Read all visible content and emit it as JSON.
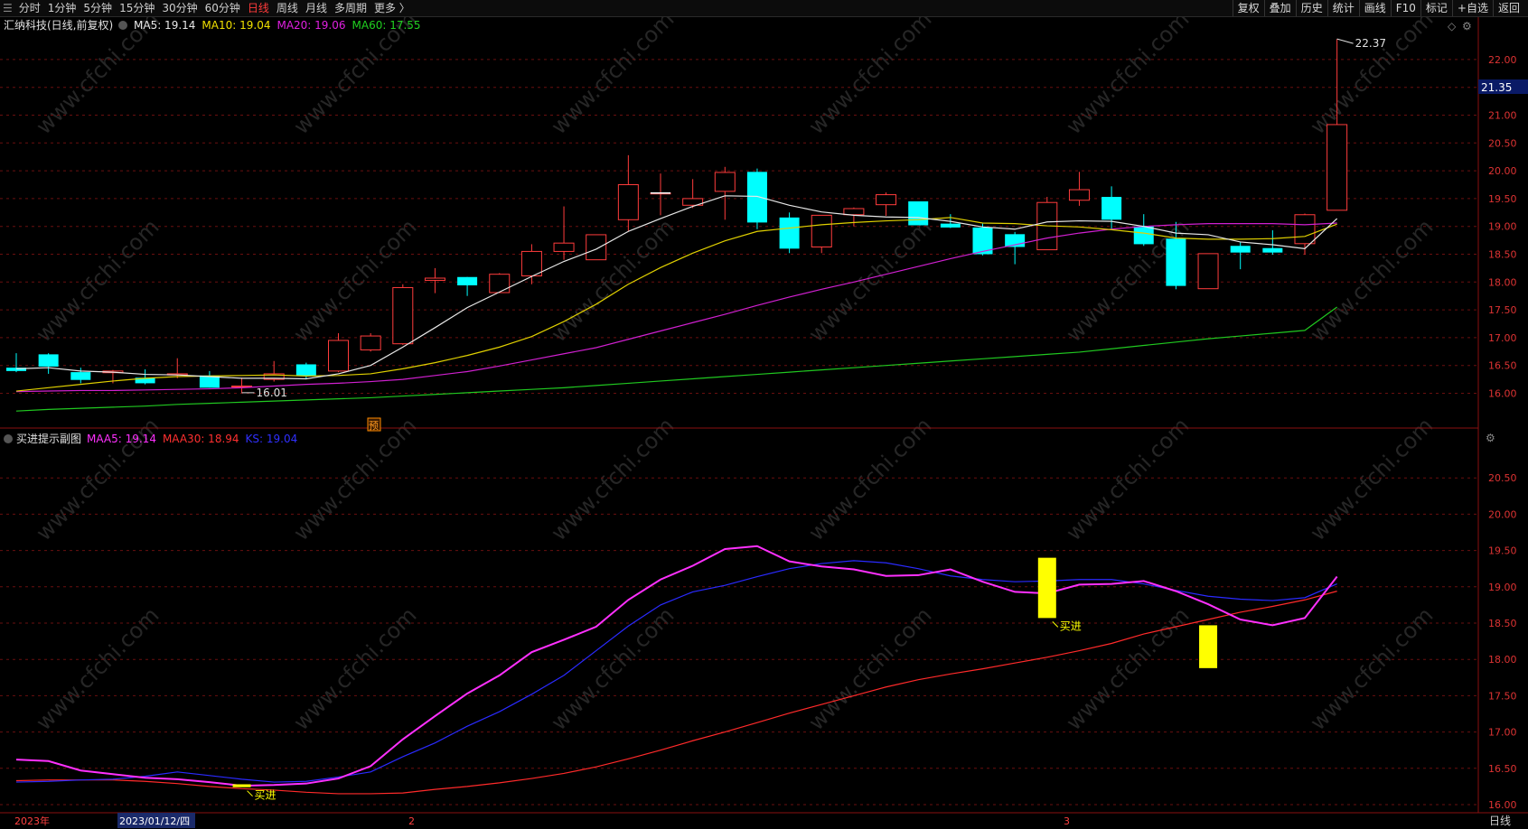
{
  "toolbar": {
    "menu_glyph": "☰",
    "left_items": [
      {
        "label": "分时",
        "active": false
      },
      {
        "label": "1分钟",
        "active": false
      },
      {
        "label": "5分钟",
        "active": false
      },
      {
        "label": "15分钟",
        "active": false
      },
      {
        "label": "30分钟",
        "active": false
      },
      {
        "label": "60分钟",
        "active": false
      },
      {
        "label": "日线",
        "active": true
      },
      {
        "label": "周线",
        "active": false
      },
      {
        "label": "月线",
        "active": false
      },
      {
        "label": "多周期",
        "active": false
      },
      {
        "label": "更多 〉",
        "active": false
      }
    ],
    "right_items": [
      "复权",
      "叠加",
      "历史",
      "统计",
      "画线",
      "F10",
      "标记",
      "+自选",
      "返回"
    ]
  },
  "main_panel": {
    "title": "汇纳科技(日线,前复权)",
    "indicators": [
      {
        "label": "MA5: 19.14",
        "color": "#e8e8e8"
      },
      {
        "label": "MA10: 19.04",
        "color": "#f0e000"
      },
      {
        "label": "MA20: 19.06",
        "color": "#e020e0"
      },
      {
        "label": "MA60: 17.55",
        "color": "#20d020"
      }
    ],
    "price_label": "21.35",
    "high_label": "22.37",
    "low_label": "16.01",
    "forecast_badge": "预",
    "y_ticks": [
      "22.00",
      "21.50",
      "21.00",
      "20.50",
      "20.00",
      "19.50",
      "19.00",
      "18.50",
      "18.00",
      "17.50",
      "17.00",
      "16.50",
      "16.00"
    ]
  },
  "sub_panel": {
    "title": "买进提示副图",
    "indicators": [
      {
        "label": "MAA5: 19.14",
        "color": "#ff30ff"
      },
      {
        "label": "MAA30: 18.94",
        "color": "#ff3030"
      },
      {
        "label": "KS: 19.04",
        "color": "#3030ff"
      }
    ],
    "buy_label": "买进",
    "y_ticks": [
      "20.50",
      "20.00",
      "19.50",
      "19.00",
      "18.50",
      "18.00",
      "17.50",
      "17.00",
      "16.50",
      "16.00"
    ]
  },
  "x_axis": {
    "labels": [
      "2023年",
      "2023/01/12/四",
      "2",
      "3"
    ],
    "period_label": "日线"
  },
  "watermark": "www.cfchi.com",
  "chart_data": {
    "type": "candlestick",
    "title": "汇纳科技(日线,前复权)",
    "candles": [
      {
        "o": 16.46,
        "h": 16.72,
        "l": 16.38,
        "c": 16.4
      },
      {
        "o": 16.7,
        "h": 16.72,
        "l": 16.35,
        "c": 16.48
      },
      {
        "o": 16.38,
        "h": 16.46,
        "l": 16.18,
        "c": 16.24
      },
      {
        "o": 16.37,
        "h": 16.42,
        "l": 16.18,
        "c": 16.4
      },
      {
        "o": 16.28,
        "h": 16.43,
        "l": 16.16,
        "c": 16.18
      },
      {
        "o": 16.33,
        "h": 16.63,
        "l": 16.27,
        "c": 16.35
      },
      {
        "o": 16.32,
        "h": 16.4,
        "l": 16.1,
        "c": 16.1
      },
      {
        "o": 16.13,
        "h": 16.28,
        "l": 16.01,
        "c": 16.13
      },
      {
        "o": 16.25,
        "h": 16.58,
        "l": 16.21,
        "c": 16.35
      },
      {
        "o": 16.52,
        "h": 16.55,
        "l": 16.25,
        "c": 16.31
      },
      {
        "o": 16.4,
        "h": 17.08,
        "l": 16.38,
        "c": 16.95
      },
      {
        "o": 16.78,
        "h": 17.08,
        "l": 16.75,
        "c": 17.03
      },
      {
        "o": 16.89,
        "h": 17.96,
        "l": 16.87,
        "c": 17.9
      },
      {
        "o": 18.03,
        "h": 18.25,
        "l": 17.8,
        "c": 18.07
      },
      {
        "o": 18.09,
        "h": 18.09,
        "l": 17.75,
        "c": 17.94
      },
      {
        "o": 17.81,
        "h": 18.16,
        "l": 17.8,
        "c": 18.14
      },
      {
        "o": 18.11,
        "h": 18.68,
        "l": 17.96,
        "c": 18.55
      },
      {
        "o": 18.55,
        "h": 19.36,
        "l": 18.4,
        "c": 18.7
      },
      {
        "o": 18.4,
        "h": 18.85,
        "l": 18.4,
        "c": 18.85
      },
      {
        "o": 19.12,
        "h": 20.28,
        "l": 18.92,
        "c": 19.75
      },
      {
        "o": 19.6,
        "h": 19.95,
        "l": 19.2,
        "c": 19.6
      },
      {
        "o": 19.38,
        "h": 19.85,
        "l": 19.33,
        "c": 19.5
      },
      {
        "o": 19.63,
        "h": 20.07,
        "l": 19.12,
        "c": 19.97
      },
      {
        "o": 19.98,
        "h": 20.04,
        "l": 18.95,
        "c": 19.07
      },
      {
        "o": 19.16,
        "h": 19.25,
        "l": 18.52,
        "c": 18.6
      },
      {
        "o": 18.63,
        "h": 19.2,
        "l": 18.52,
        "c": 19.2
      },
      {
        "o": 19.21,
        "h": 19.34,
        "l": 19.0,
        "c": 19.32
      },
      {
        "o": 19.39,
        "h": 19.61,
        "l": 19.19,
        "c": 19.57
      },
      {
        "o": 19.45,
        "h": 19.45,
        "l": 19.02,
        "c": 19.02
      },
      {
        "o": 19.05,
        "h": 19.22,
        "l": 18.97,
        "c": 18.98
      },
      {
        "o": 18.98,
        "h": 19.05,
        "l": 18.48,
        "c": 18.5
      },
      {
        "o": 18.86,
        "h": 18.9,
        "l": 18.32,
        "c": 18.63
      },
      {
        "o": 18.58,
        "h": 19.53,
        "l": 18.58,
        "c": 19.43
      },
      {
        "o": 19.47,
        "h": 19.98,
        "l": 19.37,
        "c": 19.66
      },
      {
        "o": 19.53,
        "h": 19.72,
        "l": 18.96,
        "c": 19.12
      },
      {
        "o": 19.0,
        "h": 19.22,
        "l": 18.65,
        "c": 18.68
      },
      {
        "o": 18.78,
        "h": 19.08,
        "l": 17.87,
        "c": 17.93
      },
      {
        "o": 17.88,
        "h": 18.51,
        "l": 17.88,
        "c": 18.51
      },
      {
        "o": 18.65,
        "h": 18.72,
        "l": 18.23,
        "c": 18.53
      },
      {
        "o": 18.61,
        "h": 18.93,
        "l": 18.49,
        "c": 18.53
      },
      {
        "o": 18.69,
        "h": 19.23,
        "l": 18.49,
        "c": 19.21
      },
      {
        "o": 19.29,
        "h": 22.37,
        "l": 19.29,
        "c": 20.83
      }
    ],
    "ma5": [
      16.44,
      16.46,
      16.4,
      16.38,
      16.34,
      16.33,
      16.3,
      16.27,
      16.27,
      16.26,
      16.35,
      16.5,
      16.83,
      17.18,
      17.54,
      17.82,
      18.1,
      18.37,
      18.59,
      18.91,
      19.14,
      19.36,
      19.55,
      19.54,
      19.38,
      19.26,
      19.2,
      19.17,
      19.16,
      19.09,
      18.99,
      18.95,
      19.08,
      19.1,
      19.09,
      19.0,
      18.88,
      18.85,
      18.72,
      18.67,
      18.6,
      19.14
    ],
    "ma10": [
      16.04,
      16.1,
      16.16,
      16.22,
      16.27,
      16.3,
      16.31,
      16.32,
      16.33,
      16.31,
      16.32,
      16.35,
      16.44,
      16.55,
      16.68,
      16.83,
      17.02,
      17.29,
      17.6,
      17.96,
      18.26,
      18.52,
      18.74,
      18.91,
      18.97,
      19.03,
      19.07,
      19.1,
      19.12,
      19.16,
      19.06,
      19.05,
      19.01,
      18.99,
      18.94,
      18.88,
      18.79,
      18.77,
      18.77,
      18.78,
      18.82,
      19.04
    ],
    "ma20": [
      16.03,
      16.04,
      16.05,
      16.05,
      16.06,
      16.07,
      16.08,
      16.1,
      16.13,
      16.16,
      16.18,
      16.21,
      16.25,
      16.32,
      16.39,
      16.49,
      16.6,
      16.71,
      16.82,
      16.97,
      17.12,
      17.27,
      17.42,
      17.58,
      17.73,
      17.87,
      18.0,
      18.14,
      18.28,
      18.42,
      18.55,
      18.67,
      18.79,
      18.88,
      18.95,
      19.0,
      19.03,
      19.05,
      19.05,
      19.05,
      19.03,
      19.06
    ],
    "ma60": [
      15.68,
      15.71,
      15.73,
      15.75,
      15.77,
      15.8,
      15.82,
      15.84,
      15.86,
      15.88,
      15.9,
      15.92,
      15.95,
      15.98,
      16.01,
      16.04,
      16.07,
      16.1,
      16.14,
      16.18,
      16.22,
      16.26,
      16.3,
      16.34,
      16.38,
      16.42,
      16.46,
      16.5,
      16.54,
      16.58,
      16.62,
      16.66,
      16.7,
      16.74,
      16.8,
      16.86,
      16.92,
      16.98,
      17.03,
      17.08,
      17.13,
      17.55
    ],
    "sub_ylim": [
      15.9,
      21.1
    ],
    "maa5": [
      16.62,
      16.6,
      16.47,
      16.42,
      16.37,
      16.35,
      16.31,
      16.26,
      16.27,
      16.29,
      16.36,
      16.53,
      16.9,
      17.22,
      17.53,
      17.78,
      18.1,
      18.27,
      18.45,
      18.82,
      19.1,
      19.29,
      19.52,
      19.56,
      19.35,
      19.28,
      19.24,
      19.15,
      19.16,
      19.24,
      19.07,
      18.93,
      18.91,
      19.03,
      19.04,
      19.08,
      18.94,
      18.76,
      18.55,
      18.47,
      18.57,
      19.14
    ],
    "maa30": [
      16.33,
      16.34,
      16.34,
      16.34,
      16.32,
      16.29,
      16.25,
      16.22,
      16.2,
      16.17,
      16.15,
      16.15,
      16.16,
      16.21,
      16.25,
      16.3,
      16.36,
      16.43,
      16.52,
      16.63,
      16.75,
      16.88,
      17.0,
      17.13,
      17.26,
      17.38,
      17.5,
      17.62,
      17.72,
      17.8,
      17.87,
      17.95,
      18.03,
      18.12,
      18.22,
      18.35,
      18.45,
      18.55,
      18.65,
      18.73,
      18.82,
      18.94
    ],
    "ks": [
      16.31,
      16.32,
      16.34,
      16.35,
      16.39,
      16.45,
      16.4,
      16.35,
      16.31,
      16.32,
      16.38,
      16.45,
      16.66,
      16.85,
      17.08,
      17.28,
      17.52,
      17.78,
      18.12,
      18.46,
      18.75,
      18.93,
      19.02,
      19.14,
      19.25,
      19.32,
      19.36,
      19.33,
      19.25,
      19.15,
      19.1,
      19.07,
      19.08,
      19.1,
      19.1,
      19.04,
      18.95,
      18.87,
      18.83,
      18.81,
      18.85,
      19.04
    ],
    "buy_signals": [
      {
        "index": 7,
        "top": 16.28,
        "bottom": 16.24
      },
      {
        "index": 32,
        "top": 19.4,
        "bottom": 18.57
      },
      {
        "index": 37,
        "top": 18.47,
        "bottom": 17.88
      }
    ]
  }
}
